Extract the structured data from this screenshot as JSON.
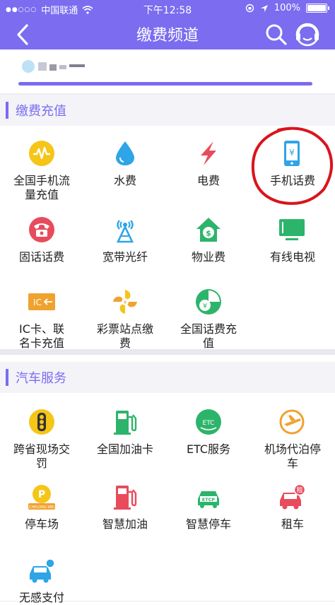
{
  "status_bar": {
    "carrier": "中国联通",
    "time": "下午12:58",
    "battery": "100%"
  },
  "nav": {
    "title": "缴费频道",
    "back_icon": "back-icon",
    "search_icon": "search-icon",
    "service_icon": "customer-service-icon"
  },
  "colors": {
    "accent": "#7b6cf0",
    "yellow": "#f5c518",
    "blue": "#2fa4e7",
    "red": "#e84c5c",
    "green": "#2db46b",
    "orange": "#f0a22e",
    "highlight": "#d9141e"
  },
  "sections": [
    {
      "title": "缴费充值"
    },
    {
      "title": "汽车服务"
    }
  ],
  "payment_items": [
    {
      "label": "全国手机流量充值",
      "line1": "全国手机流",
      "line2": "量充值",
      "icon": "data-traffic-icon"
    },
    {
      "label": "水费",
      "line1": "水费",
      "line2": "",
      "icon": "water-drop-icon"
    },
    {
      "label": "电费",
      "line1": "电费",
      "line2": "",
      "icon": "lightning-icon"
    },
    {
      "label": "手机话费",
      "line1": "手机话费",
      "line2": "",
      "icon": "mobile-phone-yuan-icon"
    },
    {
      "label": "固话话费",
      "line1": "固话话费",
      "line2": "",
      "icon": "landline-phone-icon"
    },
    {
      "label": "宽带光纤",
      "line1": "宽带光纤",
      "line2": "",
      "icon": "broadband-antenna-icon"
    },
    {
      "label": "物业费",
      "line1": "物业费",
      "line2": "",
      "icon": "property-house-icon"
    },
    {
      "label": "有线电视",
      "line1": "有线电视",
      "line2": "",
      "icon": "tv-icon"
    },
    {
      "label": "IC卡、联名卡充值",
      "line1": "IC卡、联",
      "line2": "名卡充值",
      "icon": "ic-card-icon",
      "icon_text": "IC"
    },
    {
      "label": "彩票站点缴费",
      "line1": "彩票站点缴",
      "line2": "费",
      "icon": "lottery-pinwheel-icon"
    },
    {
      "label": "全国话费充值",
      "line1": "全国话费充",
      "line2": "值",
      "icon": "phone-bill-recharge-icon"
    }
  ],
  "car_items": [
    {
      "label": "跨省现场交罚",
      "line1": "跨省现场交",
      "line2": "罚",
      "icon": "traffic-light-icon"
    },
    {
      "label": "全国加油卡",
      "line1": "全国加油卡",
      "line2": "",
      "icon": "fuel-pump-icon"
    },
    {
      "label": "ETC服务",
      "line1": "ETC服务",
      "line2": "",
      "icon": "etc-badge-icon",
      "icon_text": "ETC"
    },
    {
      "label": "机场代泊停车",
      "line1": "机场代泊停",
      "line2": "车",
      "icon": "airport-parking-icon"
    },
    {
      "label": "停车场",
      "line1": "停车场",
      "line2": "",
      "icon": "parking-lot-icon",
      "icon_text": "P",
      "icon_subtext": "CHELONG WEI"
    },
    {
      "label": "智慧加油",
      "line1": "智慧加油",
      "line2": "",
      "icon": "smart-fuel-icon"
    },
    {
      "label": "智慧停车",
      "line1": "智慧停车",
      "line2": "",
      "icon": "etcp-car-icon",
      "icon_text": "ETCP"
    },
    {
      "label": "租车",
      "line1": "租车",
      "line2": "",
      "icon": "car-rental-icon",
      "icon_text": "租"
    },
    {
      "label": "无感支付",
      "line1": "无感支付",
      "line2": "",
      "icon": "car-pay-icon"
    }
  ]
}
